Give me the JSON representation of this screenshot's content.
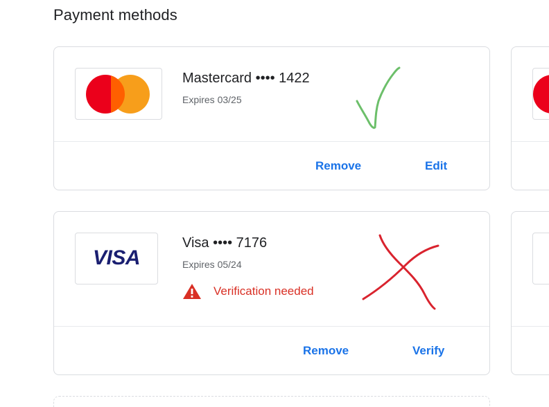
{
  "page": {
    "title": "Payment methods"
  },
  "cards": [
    {
      "brand_icon": "mastercard-logo",
      "name": "Mastercard •••• 1422",
      "expires": "Expires 03/25",
      "status_mark": "green-check",
      "actions": {
        "remove": "Remove",
        "edit": "Edit"
      }
    },
    {
      "brand_icon": "visa-logo",
      "brand_text": "VISA",
      "name": "Visa •••• 7176",
      "expires": "Expires 05/24",
      "warning": {
        "icon": "warning-triangle-icon",
        "text": "Verification needed"
      },
      "status_mark": "red-cross",
      "actions": {
        "remove": "Remove",
        "verify": "Verify"
      }
    }
  ],
  "colors": {
    "link": "#1a73e8",
    "warning": "#d93025",
    "mastercard_red": "#eb001b",
    "mastercard_orange": "#f79e1b",
    "visa_blue": "#1a1f71",
    "check_mark": "#6cbf6a",
    "cross_mark": "#d9232e"
  }
}
